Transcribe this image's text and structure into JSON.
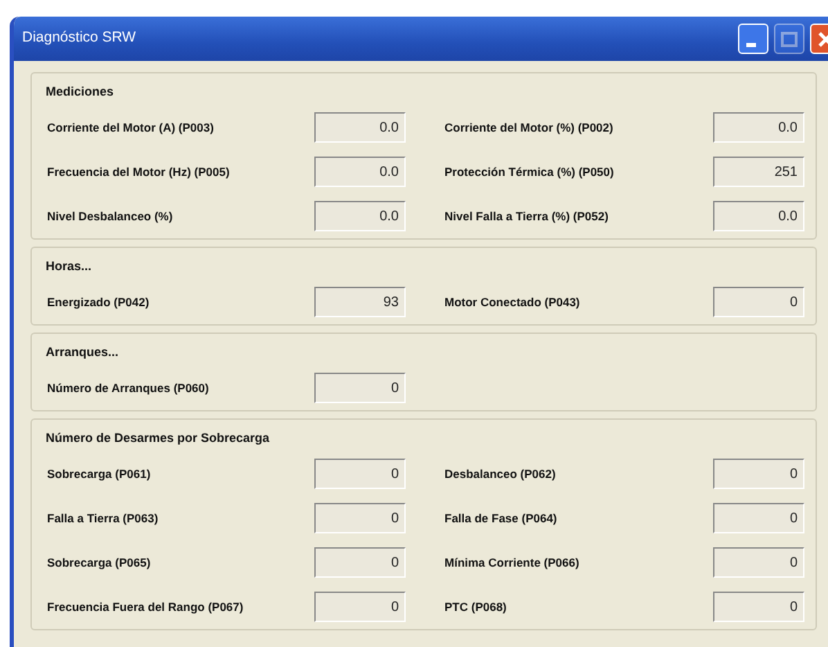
{
  "window": {
    "title": "Diagnóstico SRW",
    "controls": [
      {
        "kind": "minimize",
        "disabled": false
      },
      {
        "kind": "maximize",
        "disabled": true
      },
      {
        "kind": "close",
        "disabled": false
      }
    ]
  },
  "groups": [
    {
      "title": "Mediciones",
      "fields": [
        {
          "label": "Corriente del Motor (A) (P003)",
          "value": "0.0"
        },
        {
          "label": "Corriente del Motor (%) (P002)",
          "value": "0.0"
        },
        {
          "label": "Frecuencia del Motor (Hz) (P005)",
          "value": "0.0"
        },
        {
          "label": "Protección Térmica (%) (P050)",
          "value": "251"
        },
        {
          "label": "Nivel Desbalanceo (%)",
          "value": "0.0"
        },
        {
          "label": "Nivel Falla a Tierra (%) (P052)",
          "value": "0.0"
        }
      ]
    },
    {
      "title": "Horas...",
      "fields": [
        {
          "label": "Energizado (P042)",
          "value": "93"
        },
        {
          "label": "Motor Conectado (P043)",
          "value": "0"
        }
      ]
    },
    {
      "title": "Arranques...",
      "fields": [
        {
          "label": "Número de Arranques (P060)",
          "value": "0"
        }
      ]
    },
    {
      "title": "Número de Desarmes por Sobrecarga",
      "fields": [
        {
          "label": "Sobrecarga (P061)",
          "value": "0"
        },
        {
          "label": "Desbalanceo (P062)",
          "value": "0"
        },
        {
          "label": "Falla a Tierra (P063)",
          "value": "0"
        },
        {
          "label": "Falla de Fase (P064)",
          "value": "0"
        },
        {
          "label": "Sobrecarga (P065)",
          "value": "0"
        },
        {
          "label": "Mínima Corriente (P066)",
          "value": "0"
        },
        {
          "label": "Frecuencia Fuera del Rango (P067)",
          "value": "0"
        },
        {
          "label": "PTC (P068)",
          "value": "0"
        }
      ]
    }
  ]
}
